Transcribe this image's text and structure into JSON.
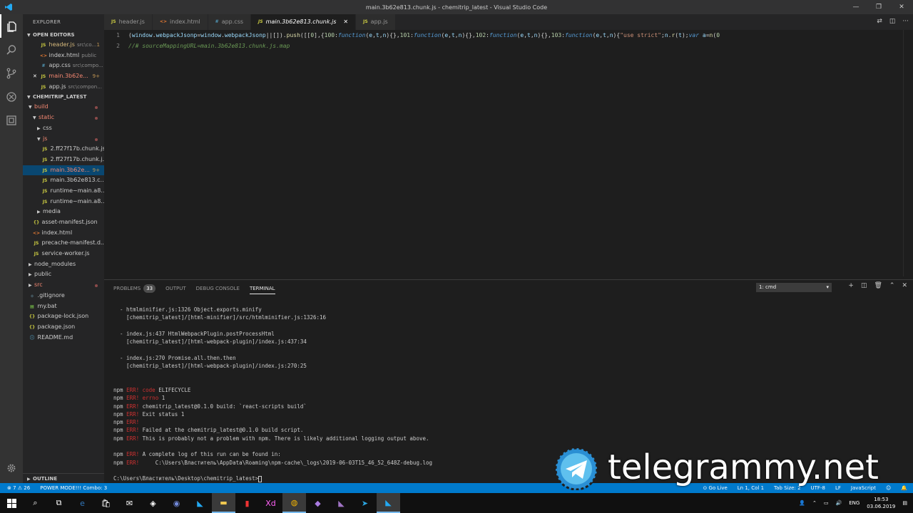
{
  "window": {
    "title": "main.3b62e813.chunk.js - chemitrip_latest - Visual Studio Code"
  },
  "sidebar": {
    "header": "EXPLORER",
    "open_editors_label": "OPEN EDITORS",
    "open_editors": [
      {
        "icon": "JS",
        "name": "header.js",
        "sub": "src\\co...",
        "badge": "1",
        "state": "warn"
      },
      {
        "icon": "<>",
        "name": "index.html",
        "sub": "public",
        "badge": "",
        "state": ""
      },
      {
        "icon": "#",
        "name": "app.css",
        "sub": "src\\compo...",
        "badge": "",
        "state": ""
      },
      {
        "icon": "JS",
        "name": "main.3b62e...",
        "sub": "",
        "badge": "9+",
        "state": "err"
      },
      {
        "icon": "JS",
        "name": "app.js",
        "sub": "src\\compon...",
        "badge": "",
        "state": ""
      }
    ],
    "project_label": "CHEMITRIP_LATEST",
    "tree": [
      {
        "depth": 0,
        "caret": "v",
        "icon": "",
        "name": "build",
        "state": "err",
        "dot": true
      },
      {
        "depth": 1,
        "caret": "v",
        "icon": "",
        "name": "static",
        "state": "err",
        "dot": true
      },
      {
        "depth": 2,
        "caret": ">",
        "icon": "",
        "name": "css",
        "state": "",
        "dot": false
      },
      {
        "depth": 2,
        "caret": "v",
        "icon": "",
        "name": "js",
        "state": "err",
        "dot": true
      },
      {
        "depth": 3,
        "caret": "",
        "icon": "JS",
        "name": "2.ff27f17b.chunk.js",
        "state": "",
        "dot": false
      },
      {
        "depth": 3,
        "caret": "",
        "icon": "JS",
        "name": "2.ff27f17b.chunk.j...",
        "state": "",
        "dot": false
      },
      {
        "depth": 3,
        "caret": "",
        "icon": "JS",
        "name": "main.3b62e...",
        "state": "err",
        "badge": "9+",
        "selected": true
      },
      {
        "depth": 3,
        "caret": "",
        "icon": "JS",
        "name": "main.3b62e813.c...",
        "state": "",
        "dot": false
      },
      {
        "depth": 3,
        "caret": "",
        "icon": "JS",
        "name": "runtime~main.a8...",
        "state": "",
        "dot": false
      },
      {
        "depth": 3,
        "caret": "",
        "icon": "JS",
        "name": "runtime~main.a8...",
        "state": "",
        "dot": false
      },
      {
        "depth": 2,
        "caret": ">",
        "icon": "",
        "name": "media",
        "state": "",
        "dot": false
      },
      {
        "depth": 1,
        "caret": "",
        "icon": "{}",
        "name": "asset-manifest.json",
        "state": "",
        "dot": false
      },
      {
        "depth": 1,
        "caret": "",
        "icon": "<>",
        "name": "index.html",
        "state": "",
        "dot": false
      },
      {
        "depth": 1,
        "caret": "",
        "icon": "JS",
        "name": "precache-manifest.d...",
        "state": "",
        "dot": false
      },
      {
        "depth": 1,
        "caret": "",
        "icon": "JS",
        "name": "service-worker.js",
        "state": "",
        "dot": false
      },
      {
        "depth": 0,
        "caret": ">",
        "icon": "",
        "name": "node_modules",
        "state": "",
        "dot": false
      },
      {
        "depth": 0,
        "caret": ">",
        "icon": "",
        "name": "public",
        "state": "",
        "dot": false
      },
      {
        "depth": 0,
        "caret": ">",
        "icon": "",
        "name": "src",
        "state": "err",
        "dot": true
      },
      {
        "depth": 0,
        "caret": "",
        "icon": "◆",
        "name": ".gitignore",
        "state": "",
        "dot": false
      },
      {
        "depth": 0,
        "caret": "",
        "icon": "▤",
        "name": "my.bat",
        "state": "",
        "dot": false
      },
      {
        "depth": 0,
        "caret": "",
        "icon": "{}",
        "name": "package-lock.json",
        "state": "",
        "dot": false
      },
      {
        "depth": 0,
        "caret": "",
        "icon": "{}",
        "name": "package.json",
        "state": "",
        "dot": false
      },
      {
        "depth": 0,
        "caret": "",
        "icon": "ⓘ",
        "name": "README.md",
        "state": "",
        "dot": false
      }
    ],
    "outline_label": "OUTLINE"
  },
  "tabs": [
    {
      "icon": "JS",
      "label": "header.js",
      "active": false
    },
    {
      "icon": "<>",
      "label": "index.html",
      "active": false
    },
    {
      "icon": "#",
      "label": "app.css",
      "active": false
    },
    {
      "icon": "JS",
      "label": "main.3b62e813.chunk.js",
      "active": true
    },
    {
      "icon": "JS",
      "label": "app.js",
      "active": false
    }
  ],
  "editor": {
    "line1_num": "1",
    "line2_num": "2",
    "line2": "//# sourceMappingURL=main.3b62e813.chunk.js.map"
  },
  "panel": {
    "tabs": [
      "PROBLEMS",
      "OUTPUT",
      "DEBUG CONSOLE",
      "TERMINAL"
    ],
    "problems_count": "33",
    "terminal_select": "1: cmd",
    "lines": [
      "  - htmlminifier.js:1326 Object.exports.minify",
      "    [chemitrip_latest]/[html-minifier]/src/htmlminifier.js:1326:16",
      "",
      "  - index.js:437 HtmlWebpackPlugin.postProcessHtml",
      "    [chemitrip_latest]/[html-webpack-plugin]/index.js:437:34",
      "",
      "  - index.js:270 Promise.all.then.then",
      "    [chemitrip_latest]/[html-webpack-plugin]/index.js:270:25",
      "",
      "",
      "npm ERR! code ELIFECYCLE",
      "npm ERR! errno 1",
      "npm ERR! chemitrip_latest@0.1.0 build: `react-scripts build`",
      "npm ERR! Exit status 1",
      "npm ERR!",
      "npm ERR! Failed at the chemitrip_latest@0.1.0 build script.",
      "npm ERR! This is probably not a problem with npm. There is likely additional logging output above.",
      "",
      "npm ERR! A complete log of this run can be found in:",
      "npm ERR!     C:\\Users\\Властитель\\AppData\\Roaming\\npm-cache\\_logs\\2019-06-03T15_46_52_648Z-debug.log",
      "",
      "C:\\Users\\Властитель\\Desktop\\chemitrip_latest>"
    ]
  },
  "statusbar": {
    "errors": "7",
    "warnings": "26",
    "power_mode": "POWER MODE!!! Combo: 3",
    "go_live": "Go Live",
    "position": "Ln 1, Col 1",
    "tab_size": "Tab Size: 2",
    "encoding": "UTF-8",
    "eol": "LF",
    "language": "JavaScript"
  },
  "taskbar": {
    "lang": "ENG",
    "time": "18:53",
    "date": "03.06.2019"
  },
  "watermark": {
    "text": "telegrammy.net"
  }
}
